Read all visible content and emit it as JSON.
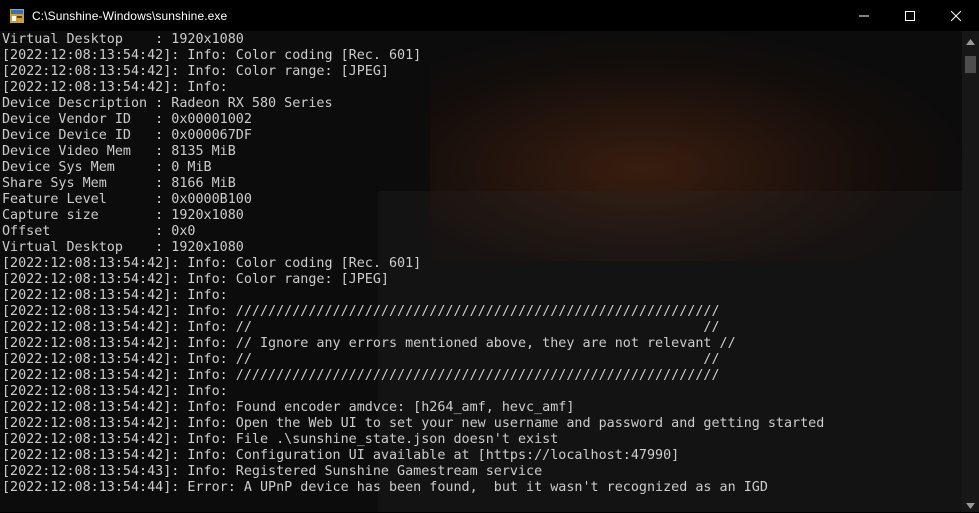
{
  "window": {
    "title": "C:\\Sunshine-Windows\\sunshine.exe",
    "app_icon": "console-app-icon",
    "buttons": {
      "minimize": "minimize-icon",
      "maximize": "maximize-icon",
      "close": "close-icon"
    }
  },
  "console": {
    "lines": [
      "Virtual Desktop    : 1920x1080",
      "[2022:12:08:13:54:42]: Info: Color coding [Rec. 601]",
      "[2022:12:08:13:54:42]: Info: Color range: [JPEG]",
      "[2022:12:08:13:54:42]: Info:",
      "Device Description : Radeon RX 580 Series",
      "Device Vendor ID   : 0x00001002",
      "Device Device ID   : 0x000067DF",
      "Device Video Mem   : 8135 MiB",
      "Device Sys Mem     : 0 MiB",
      "Share Sys Mem      : 8166 MiB",
      "Feature Level      : 0x0000B100",
      "Capture size       : 1920x1080",
      "Offset             : 0x0",
      "Virtual Desktop    : 1920x1080",
      "[2022:12:08:13:54:42]: Info: Color coding [Rec. 601]",
      "[2022:12:08:13:54:42]: Info: Color range: [JPEG]",
      "[2022:12:08:13:54:42]: Info:",
      "[2022:12:08:13:54:42]: Info: ////////////////////////////////////////////////////////////",
      "[2022:12:08:13:54:42]: Info: //                                                        //",
      "[2022:12:08:13:54:42]: Info: // Ignore any errors mentioned above, they are not relevant //",
      "[2022:12:08:13:54:42]: Info: //                                                        //",
      "[2022:12:08:13:54:42]: Info: ////////////////////////////////////////////////////////////",
      "[2022:12:08:13:54:42]: Info:",
      "[2022:12:08:13:54:42]: Info: Found encoder amdvce: [h264_amf, hevc_amf]",
      "[2022:12:08:13:54:42]: Info: Open the Web UI to set your new username and password and getting started",
      "[2022:12:08:13:54:42]: Info: File .\\sunshine_state.json doesn't exist",
      "[2022:12:08:13:54:42]: Info: Configuration UI available at [https://localhost:47990]",
      "[2022:12:08:13:54:43]: Info: Registered Sunshine Gamestream service",
      "[2022:12:08:13:54:44]: Error: A UPnP device has been found,  but it wasn't recognized as an IGD"
    ]
  },
  "scrollbar": {
    "up": "scroll-up-arrow-icon",
    "down": "scroll-down-arrow-icon"
  }
}
